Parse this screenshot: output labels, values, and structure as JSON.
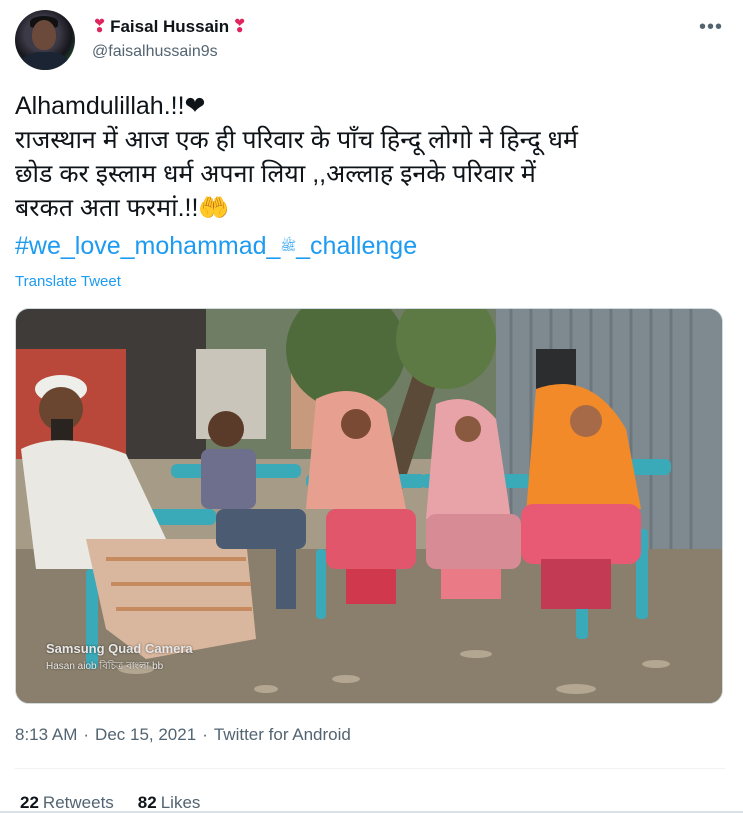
{
  "user": {
    "heart_left": "❣",
    "display_name": "Faisal Hussain",
    "heart_right": "❣",
    "handle": "@faisalhussain9s"
  },
  "menu": {
    "more_label": "•••"
  },
  "tweet": {
    "lines": [
      "Alhamdulillah.!!❤",
      "राजस्थान में आज एक ही परिवार के पाँच हिन्दू लोगो ने हिन्दू धर्म",
      "छोड कर इस्लाम धर्म अपना लिया ,,अल्लाह इनके परिवार में",
      "बरकत अता फरमां.!!🤲"
    ],
    "hashtag_start": "#we_love_mohammad_",
    "hashtag_symbol": "ﷺ",
    "hashtag_end": "_challenge",
    "translate_label": "Translate Tweet"
  },
  "photo": {
    "camera_label": "Samsung Quad Camera",
    "camera_sub": "Hasan aiob বিচিত্র বাংলা bb"
  },
  "meta": {
    "time": "8:13 AM",
    "separator": "·",
    "date": "Dec 15, 2021",
    "separator2": "·",
    "source": "Twitter for Android"
  },
  "stats": {
    "retweets_count": "22",
    "retweets_label": "Retweets",
    "likes_count": "82",
    "likes_label": "Likes"
  },
  "colors": {
    "link": "#1d9bf0",
    "secondary_text": "#536471",
    "heart": "#e0245e"
  }
}
